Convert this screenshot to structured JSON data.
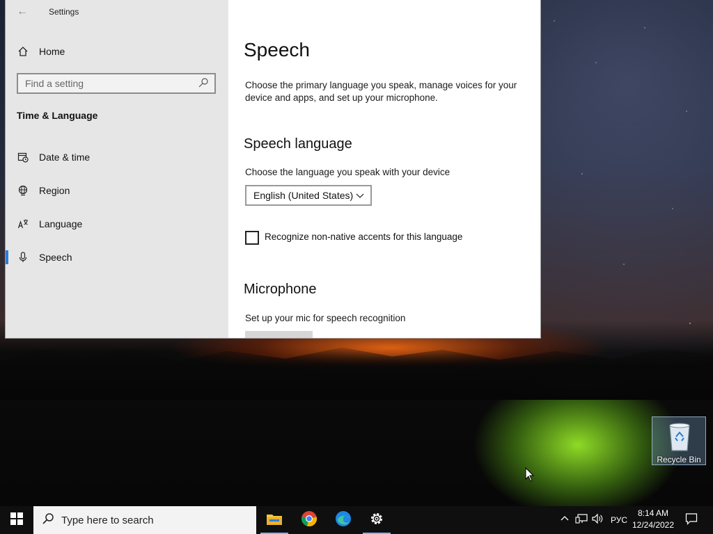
{
  "window": {
    "title": "Settings",
    "sidebar": {
      "home_label": "Home",
      "search_placeholder": "Find a setting",
      "section_title": "Time & Language",
      "items": [
        {
          "label": "Date & time",
          "icon": "calendar-clock-icon"
        },
        {
          "label": "Region",
          "icon": "globe-icon"
        },
        {
          "label": "Language",
          "icon": "language-icon"
        },
        {
          "label": "Speech",
          "icon": "microphone-icon",
          "selected": true
        }
      ]
    },
    "content": {
      "title": "Speech",
      "description": "Choose the primary language you speak, manage voices for your device and apps, and set up your microphone.",
      "speech_language": {
        "heading": "Speech language",
        "prompt": "Choose the language you speak with your device",
        "selected_language": "English (United States)",
        "checkbox_label": "Recognize non-native accents for this language",
        "checkbox_checked": false
      },
      "microphone": {
        "heading": "Microphone",
        "prompt": "Set up your mic for speech recognition"
      }
    }
  },
  "desktop": {
    "recycle_bin_label": "Recycle Bin"
  },
  "taskbar": {
    "search_placeholder": "Type here to search",
    "apps": [
      "file-explorer-icon",
      "chrome-icon",
      "edge-icon",
      "settings-gear-icon"
    ],
    "language": "РУС",
    "time": "8:14 AM",
    "date": "12/24/2022"
  },
  "colors": {
    "accent": "#2d7bd5",
    "sidebar_bg": "#e6e6e6",
    "taskbar_bg": "#0f0f0f"
  }
}
